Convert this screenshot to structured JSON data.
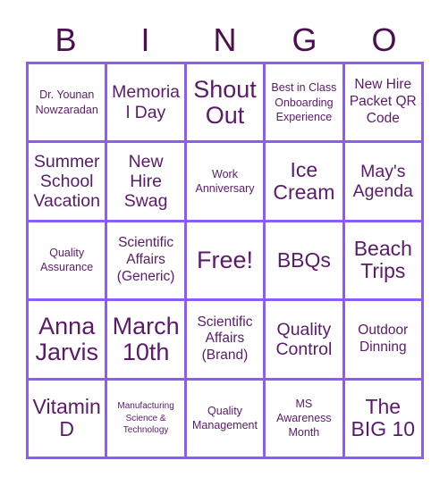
{
  "header": {
    "letters": [
      "B",
      "I",
      "N",
      "G",
      "O"
    ],
    "letter_color": "#4b0f50"
  },
  "colors": {
    "grid_border": "#8b5cf6",
    "cell_text": "#5b1a6b",
    "cell_background": "#ffffff",
    "page_background": "#ffffff"
  },
  "grid": {
    "rows": 5,
    "columns": 5,
    "free_space_index": 12,
    "cells": [
      {
        "text": "Dr. Younan Nowzaradan",
        "size": "sz-sm"
      },
      {
        "text": "Memorial Day",
        "size": "sz-lg"
      },
      {
        "text": "Shout Out",
        "size": "sz-xxl"
      },
      {
        "text": "Best in Class Onboarding Experience",
        "size": "sz-sm"
      },
      {
        "text": "New Hire Packet QR Code",
        "size": "sz-md"
      },
      {
        "text": "Summer School Vacation",
        "size": "sz-lg"
      },
      {
        "text": "New Hire Swag",
        "size": "sz-lg"
      },
      {
        "text": "Work Anniversary",
        "size": "sz-sm"
      },
      {
        "text": "Ice Cream",
        "size": "sz-xl"
      },
      {
        "text": "May's Agenda",
        "size": "sz-lg"
      },
      {
        "text": "Quality Assurance",
        "size": "sz-sm"
      },
      {
        "text": "Scientific Affairs (Generic)",
        "size": "sz-md"
      },
      {
        "text": "Free!",
        "size": "sz-xxl"
      },
      {
        "text": "BBQs",
        "size": "sz-xl"
      },
      {
        "text": "Beach Trips",
        "size": "sz-xl"
      },
      {
        "text": "Anna Jarvis",
        "size": "sz-xxl"
      },
      {
        "text": "March 10th",
        "size": "sz-xxl"
      },
      {
        "text": "Scientific Affairs (Brand)",
        "size": "sz-md"
      },
      {
        "text": "Quality Control",
        "size": "sz-lg"
      },
      {
        "text": "Outdoor Dinning",
        "size": "sz-md"
      },
      {
        "text": "Vitamin D",
        "size": "sz-xl"
      },
      {
        "text": "Manufacturing Science & Technology",
        "size": "sz-xs"
      },
      {
        "text": "Quality Management",
        "size": "sz-sm"
      },
      {
        "text": "MS Awareness Month",
        "size": "sz-sm"
      },
      {
        "text": "The BIG 10",
        "size": "sz-xl"
      }
    ]
  }
}
